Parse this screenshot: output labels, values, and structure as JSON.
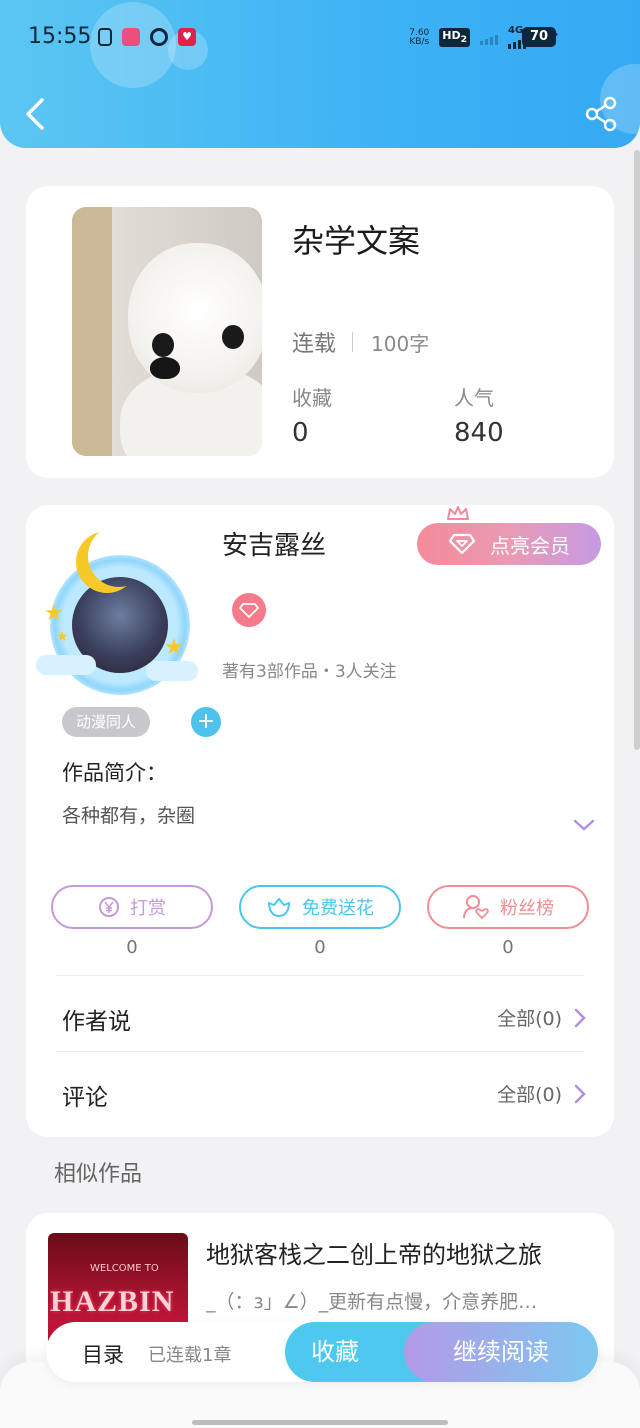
{
  "status_bar": {
    "time": "15:55",
    "net_speed_value": "7.60",
    "net_speed_unit": "KB/s",
    "hd_label": "HD",
    "hd_sub": "2",
    "network": "4G",
    "battery": "70"
  },
  "book": {
    "title": "杂学文案",
    "status": "连载",
    "word_count": "100字",
    "favorites_label": "收藏",
    "favorites_value": "0",
    "popularity_label": "人气",
    "popularity_value": "840"
  },
  "author": {
    "name": "安吉露丝",
    "vip_button": "点亮会员",
    "meta": "著有3部作品・3人关注",
    "tag": "动漫同人",
    "tag_add": "+",
    "intro_label": "作品简介：",
    "intro_text": "各种都有，杂圈"
  },
  "actions": [
    {
      "label": "打赏",
      "count": "0",
      "color": "#c59ad9"
    },
    {
      "label": "免费送花",
      "count": "0",
      "color": "#4cc6e8"
    },
    {
      "label": "粉丝榜",
      "count": "0",
      "color": "#ef8e94"
    }
  ],
  "rows": {
    "author_says": {
      "label": "作者说",
      "right": "全部(0)"
    },
    "comments": {
      "label": "评论",
      "right": "全部(0)"
    }
  },
  "similar": {
    "section_title": "相似作品",
    "items": [
      {
        "title": "地狱客栈之二创上帝的地狱之旅",
        "desc": "_（：з」∠）_更新有点慢，介意养肥…",
        "cover_text": "HAZBIN",
        "cover_small": "WELCOME TO"
      }
    ]
  },
  "bottom_bar": {
    "toc_label": "目录",
    "toc_meta": "已连载1章",
    "favorite_button": "收藏",
    "continue_button": "继续阅读"
  },
  "colors": {
    "header": "#3db2f5",
    "accent_blue": "#4ec8ee",
    "accent_purple": "#b39ae6",
    "vip_pink": "#f48a9a",
    "chevron": "#b68ee0"
  }
}
